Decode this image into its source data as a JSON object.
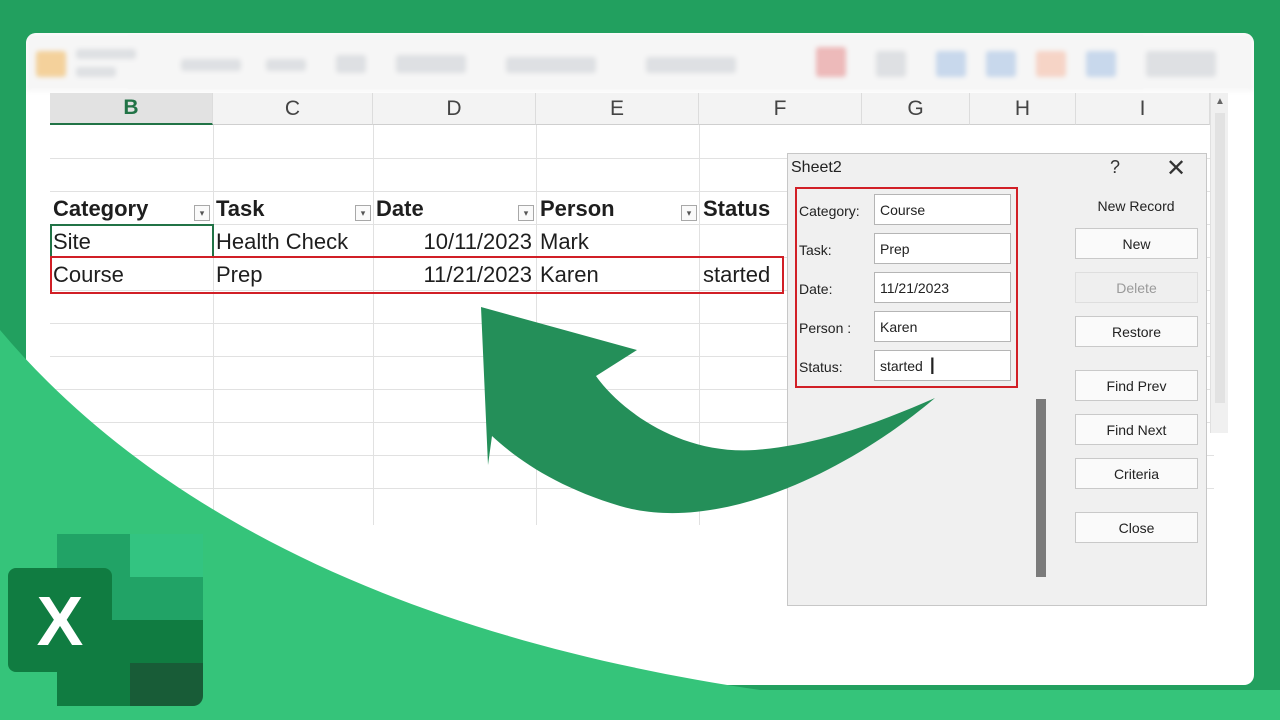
{
  "spreadsheet": {
    "columns": [
      "B",
      "C",
      "D",
      "E",
      "F",
      "G",
      "H",
      "I"
    ],
    "headers": [
      "Category",
      "Task",
      "Date",
      "Person",
      "Status"
    ],
    "rows": [
      [
        "Site",
        "Health Check",
        "10/11/2023",
        "Mark",
        ""
      ],
      [
        "Course",
        "Prep",
        "11/21/2023",
        "Karen",
        "started"
      ]
    ],
    "filter_glyph": "▾"
  },
  "dialog": {
    "title": "Sheet2",
    "help": "?",
    "close": "✕",
    "fields": [
      {
        "label": "Category:",
        "value": "Course"
      },
      {
        "label": "Task:",
        "value": "Prep"
      },
      {
        "label": "Date:",
        "value": "11/21/2023"
      },
      {
        "label": "Person :",
        "value": "Karen"
      },
      {
        "label": "Status:",
        "value": "started"
      }
    ],
    "record_status": "New Record",
    "buttons": {
      "new": "New",
      "delete": "Delete",
      "restore": "Restore",
      "find_prev": "Find Prev",
      "find_next": "Find Next",
      "criteria": "Criteria",
      "close": "Close"
    }
  },
  "logo": {
    "letter": "X"
  },
  "colors": {
    "background": "#22a05f",
    "swoosh": "#35c47a",
    "arrow": "#248f59",
    "highlight": "#d11f26",
    "excel_green": "#217346"
  }
}
